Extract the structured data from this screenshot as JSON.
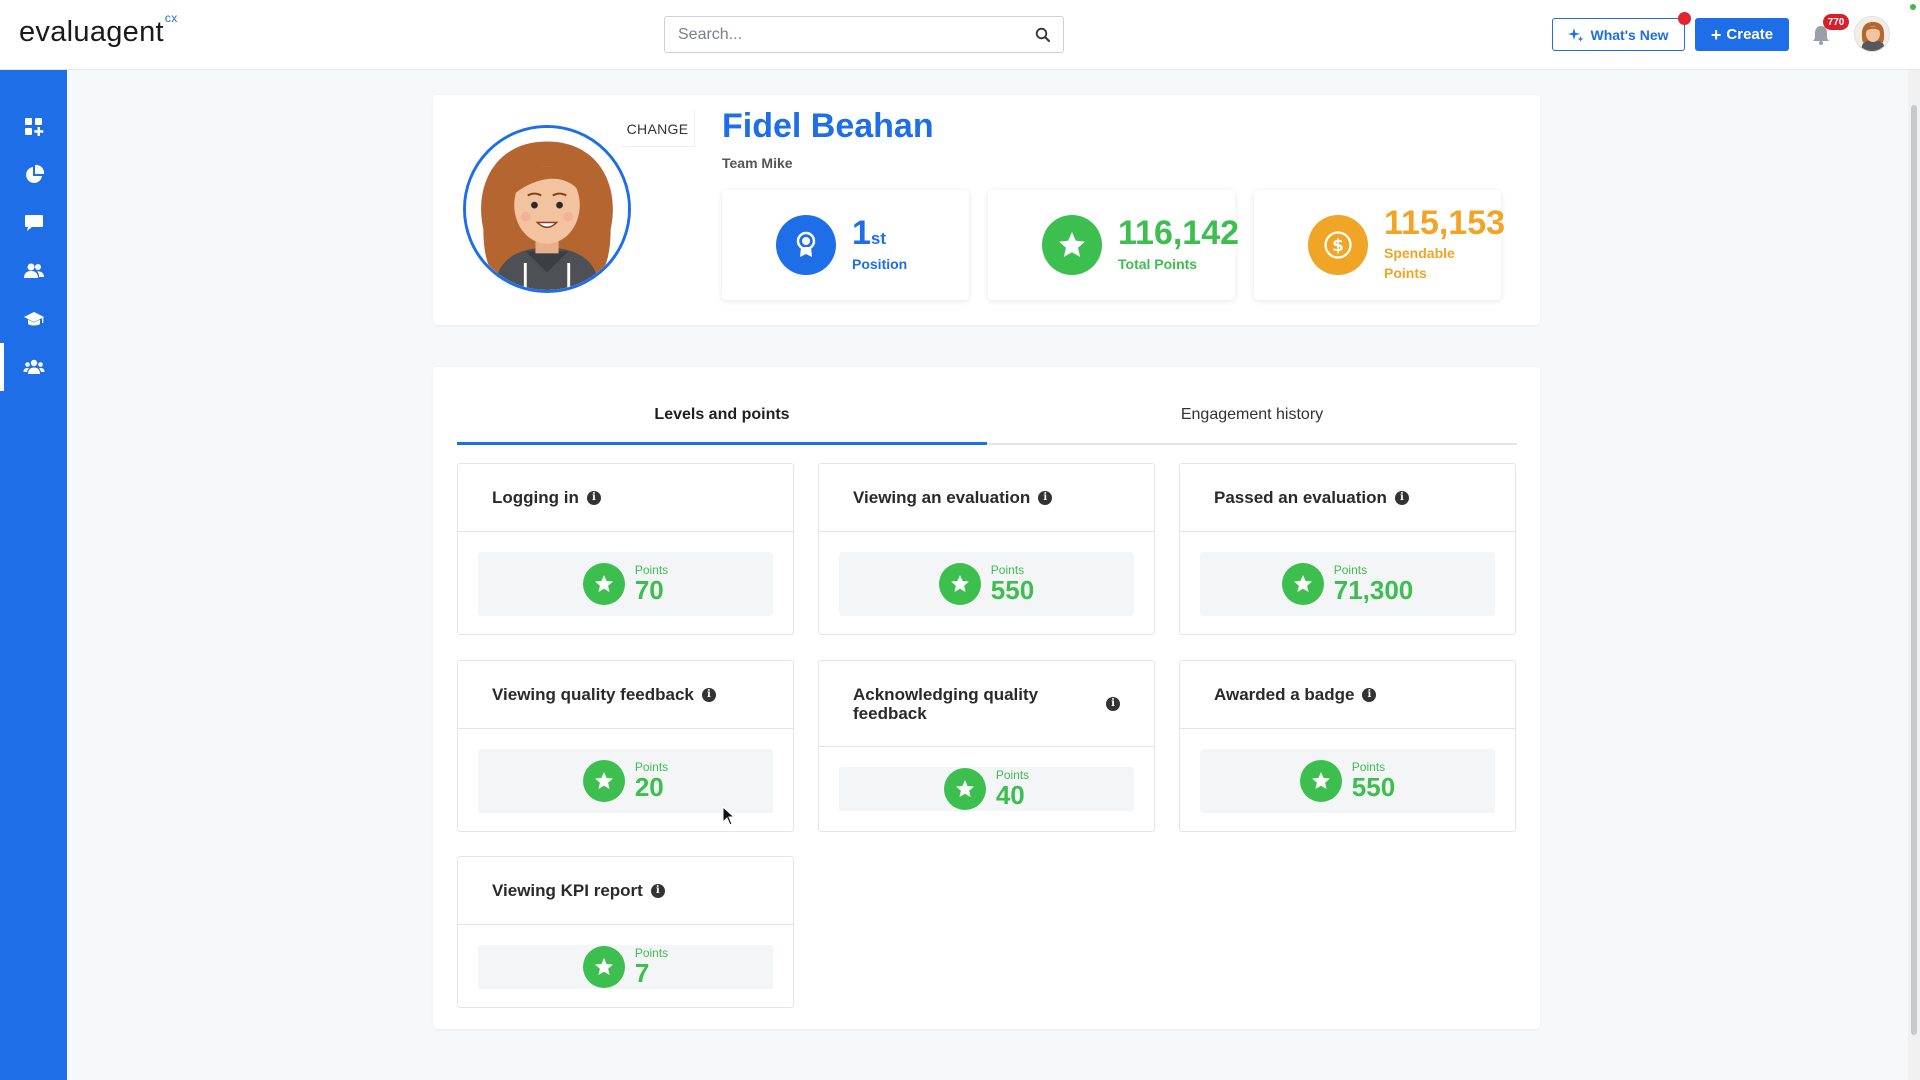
{
  "app": {
    "logo": "evaluagent",
    "logo_sup": "cx"
  },
  "header": {
    "search_placeholder": "Search...",
    "whats_new_label": "What's New",
    "create_label": "Create",
    "notification_count": "770"
  },
  "sidebar": {
    "items": [
      {
        "icon": "dashboard-add-icon"
      },
      {
        "icon": "pie-chart-icon"
      },
      {
        "icon": "chat-icon"
      },
      {
        "icon": "users-icon"
      },
      {
        "icon": "graduation-cap-icon"
      },
      {
        "icon": "team-icon",
        "active": true
      }
    ]
  },
  "profile": {
    "change_label": "CHANGE",
    "name": "Fidel Beahan",
    "team": "Team Mike",
    "stats": {
      "position_value": "1",
      "position_ord": "st",
      "position_label": "Position",
      "total_value": "116,142",
      "total_label": "Total Points",
      "spendable_value": "115,153",
      "spendable_label_1": "Spendable",
      "spendable_label_2": "Points"
    },
    "colors": {
      "position": "#1e6ee8",
      "total": "#3dbf4f",
      "spendable": "#f0a526"
    }
  },
  "tabs": [
    {
      "label": "Levels and points",
      "active": true
    },
    {
      "label": "Engagement history",
      "active": false
    }
  ],
  "points_label": "Points",
  "point_cards": [
    {
      "title": "Logging in",
      "points": "70"
    },
    {
      "title": "Viewing an evaluation",
      "points": "550"
    },
    {
      "title": "Passed an evaluation",
      "points": "71,300"
    },
    {
      "title": "Viewing quality feedback",
      "points": "20"
    },
    {
      "title": "Acknowledging quality feedback",
      "points": "40"
    },
    {
      "title": "Awarded a badge",
      "points": "550"
    },
    {
      "title": "Viewing KPI report",
      "points": "7"
    }
  ]
}
